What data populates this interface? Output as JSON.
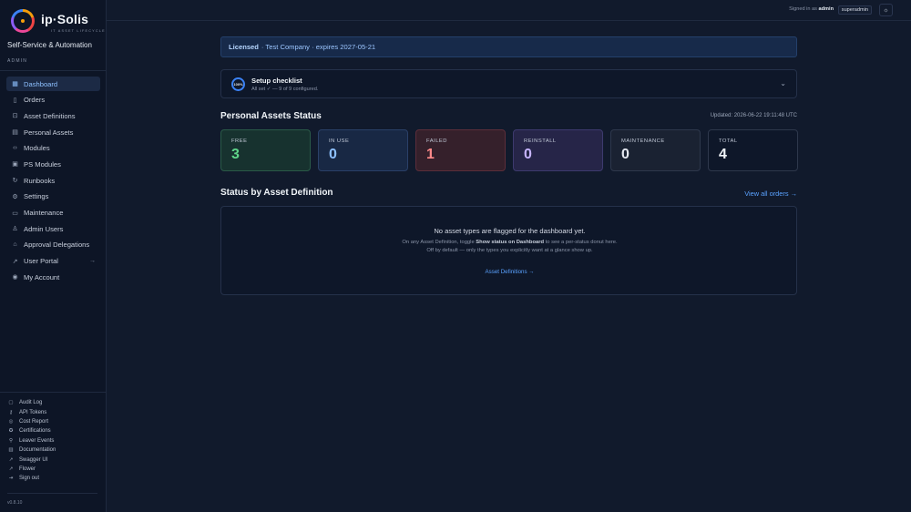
{
  "brand": {
    "name": "ip·Solis",
    "tagline": "IT ASSET LIFECYCLE",
    "org": "Self-Service & Automation",
    "role": "ADMIN"
  },
  "nav": [
    {
      "label": "Dashboard",
      "icon": "dashboard-icon",
      "active": true
    },
    {
      "label": "Orders",
      "icon": "clipboard-icon"
    },
    {
      "label": "Asset Definitions",
      "icon": "lock-icon"
    },
    {
      "label": "Personal Assets",
      "icon": "inbox-icon"
    },
    {
      "label": "Modules",
      "icon": "code-icon"
    },
    {
      "label": "PS Modules",
      "icon": "terminal-icon"
    },
    {
      "label": "Runbooks",
      "icon": "refresh-icon"
    },
    {
      "label": "Settings",
      "icon": "gear-icon"
    },
    {
      "label": "Maintenance",
      "icon": "monitor-icon"
    },
    {
      "label": "Admin Users",
      "icon": "user-icon"
    },
    {
      "label": "Approval Delegations",
      "icon": "bank-icon"
    },
    {
      "label": "User Portal",
      "icon": "external-link-icon",
      "external": true
    },
    {
      "label": "My Account",
      "icon": "user-circle-icon"
    }
  ],
  "bottom_links": [
    {
      "label": "Audit Log",
      "icon": "file-icon"
    },
    {
      "label": "API Tokens",
      "icon": "key-icon"
    },
    {
      "label": "Cost Report",
      "icon": "coin-icon"
    },
    {
      "label": "Certifications",
      "icon": "badge-icon"
    },
    {
      "label": "Leaver Events",
      "icon": "walk-icon"
    },
    {
      "label": "Documentation",
      "icon": "book-icon"
    },
    {
      "label": "Swagger UI",
      "icon": "external-link-icon"
    },
    {
      "label": "Flower",
      "icon": "external-link-icon"
    },
    {
      "label": "Sign out",
      "icon": "logout-icon"
    }
  ],
  "version": "v0.8.10",
  "topbar": {
    "signed_in_prefix": "Signed in as",
    "user": "admin",
    "role_badge": "superadmin",
    "theme_icon": "sun-icon"
  },
  "license": {
    "status": "Licensed",
    "detail": "· Test Company · expires 2027-05-21"
  },
  "checklist": {
    "percent": "100%",
    "title": "Setup checklist",
    "subtitle": "All set ✓ — 9 of 9 configured."
  },
  "status": {
    "title": "Personal Assets Status",
    "updated": "Updated: 2026-06-22 19:11:48 UTC",
    "cards": [
      {
        "label": "FREE",
        "value": "3",
        "color": "#5fd68a",
        "bg": "#17322f",
        "border": "#2a5a48"
      },
      {
        "label": "IN USE",
        "value": "0",
        "color": "#8ec1ff",
        "bg": "#182844",
        "border": "#2a4068"
      },
      {
        "label": "FAILED",
        "value": "1",
        "color": "#ff8a8a",
        "bg": "#35202b",
        "border": "#5c2e3a"
      },
      {
        "label": "REINSTALL",
        "value": "0",
        "color": "#c8b5ff",
        "bg": "#262548",
        "border": "#3d3a6e"
      },
      {
        "label": "MAINTENANCE",
        "value": "0",
        "color": "#e6eaf2",
        "bg": "#1a2232",
        "border": "#2e384c"
      },
      {
        "label": "TOTAL",
        "value": "4",
        "color": "#f1f5f9",
        "bg": "#0e1729",
        "border": "#2e384c"
      }
    ]
  },
  "by_definition": {
    "title": "Status by Asset Definition",
    "view_all": "View all orders →",
    "empty_title": "No asset types are flagged for the dashboard yet.",
    "empty_desc_1": "On any Asset Definition, toggle",
    "empty_desc_bold": "Show status on Dashboard",
    "empty_desc_2": "to see a per-status donut here. Off by default — only the types you explicitly want at a glance show up.",
    "link": "Asset Definitions →"
  }
}
